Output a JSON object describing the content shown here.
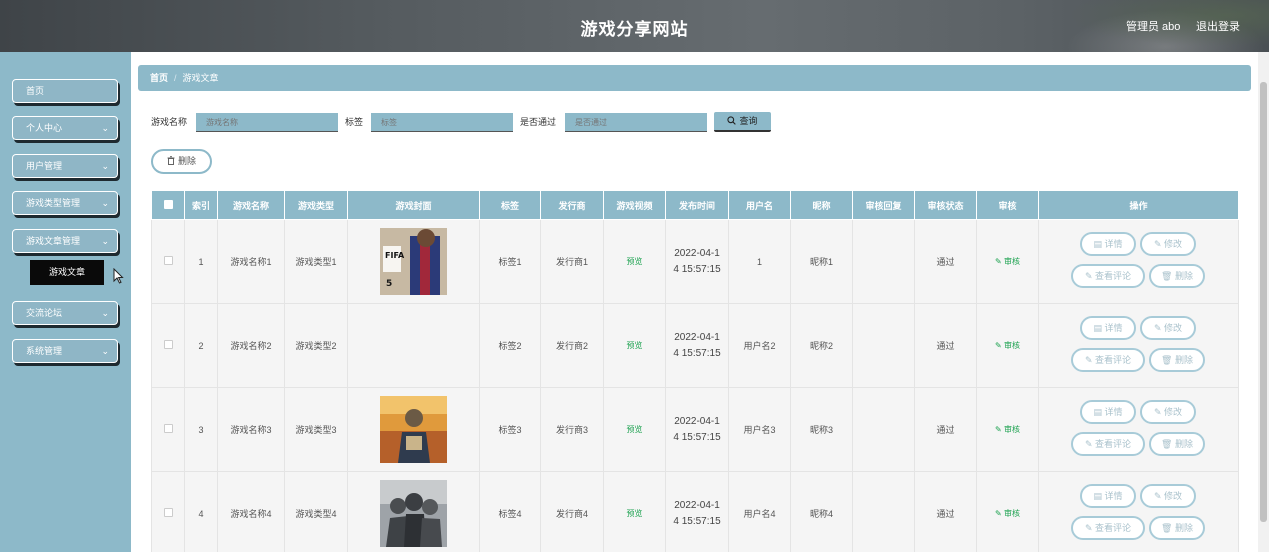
{
  "header": {
    "title": "游戏分享网站",
    "user": "管理员 abo",
    "logout": "退出登录"
  },
  "sidebar": {
    "items": [
      {
        "label": "首页",
        "has_chevron": false
      },
      {
        "label": "个人中心",
        "has_chevron": true
      },
      {
        "label": "用户管理",
        "has_chevron": true
      },
      {
        "label": "游戏类型管理",
        "has_chevron": true
      },
      {
        "label": "游戏文章管理",
        "has_chevron": true
      },
      {
        "label": "交流论坛",
        "has_chevron": true
      },
      {
        "label": "系统管理",
        "has_chevron": true
      }
    ],
    "active_sub": "游戏文章",
    "chevron": "chevron-down-icon"
  },
  "breadcrumb": {
    "home": "首页",
    "current": "游戏文章"
  },
  "filters": {
    "name_label": "游戏名称",
    "name_placeholder": "游戏名称",
    "tag_label": "标签",
    "tag_placeholder": "标签",
    "pass_label": "是否通过",
    "pass_placeholder": "是否通过",
    "search_button": "查询"
  },
  "delete_button": "删除",
  "table": {
    "columns": [
      "",
      "索引",
      "游戏名称",
      "游戏类型",
      "游戏封面",
      "标签",
      "发行商",
      "游戏视频",
      "发布时间",
      "用户名",
      "昵称",
      "审核回复",
      "审核状态",
      "审核",
      "操作"
    ],
    "rows": [
      {
        "index": "1",
        "name": "游戏名称1",
        "type": "游戏类型1",
        "cover": "fifa",
        "tag": "标签1",
        "publisher": "发行商1",
        "video": "预览",
        "date_line1": "2022-04-1",
        "date_line2": "4 15:57:15",
        "username": "1",
        "nickname": "昵称1",
        "reply": "",
        "status": "通过",
        "audit": "审核"
      },
      {
        "index": "2",
        "name": "游戏名称2",
        "type": "游戏类型2",
        "cover": "",
        "tag": "标签2",
        "publisher": "发行商2",
        "video": "预览",
        "date_line1": "2022-04-1",
        "date_line2": "4 15:57:15",
        "username": "用户名2",
        "nickname": "昵称2",
        "reply": "",
        "status": "通过",
        "audit": "审核"
      },
      {
        "index": "3",
        "name": "游戏名称3",
        "type": "游戏类型3",
        "cover": "pubg",
        "tag": "标签3",
        "publisher": "发行商3",
        "video": "预览",
        "date_line1": "2022-04-1",
        "date_line2": "4 15:57:15",
        "username": "用户名3",
        "nickname": "昵称3",
        "reply": "",
        "status": "通过",
        "audit": "审核"
      },
      {
        "index": "4",
        "name": "游戏名称4",
        "type": "游戏类型4",
        "cover": "squad",
        "tag": "标签4",
        "publisher": "发行商4",
        "video": "预览",
        "date_line1": "2022-04-1",
        "date_line2": "4 15:57:15",
        "username": "用户名4",
        "nickname": "昵称4",
        "reply": "",
        "status": "通过",
        "audit": "审核"
      }
    ],
    "row_actions": {
      "detail": "详情",
      "edit": "修改",
      "comments": "查看评论",
      "delete": "删除"
    }
  },
  "colors": {
    "accent": "#8db9c9",
    "header": "#555b5f",
    "success": "#1aa14e"
  }
}
